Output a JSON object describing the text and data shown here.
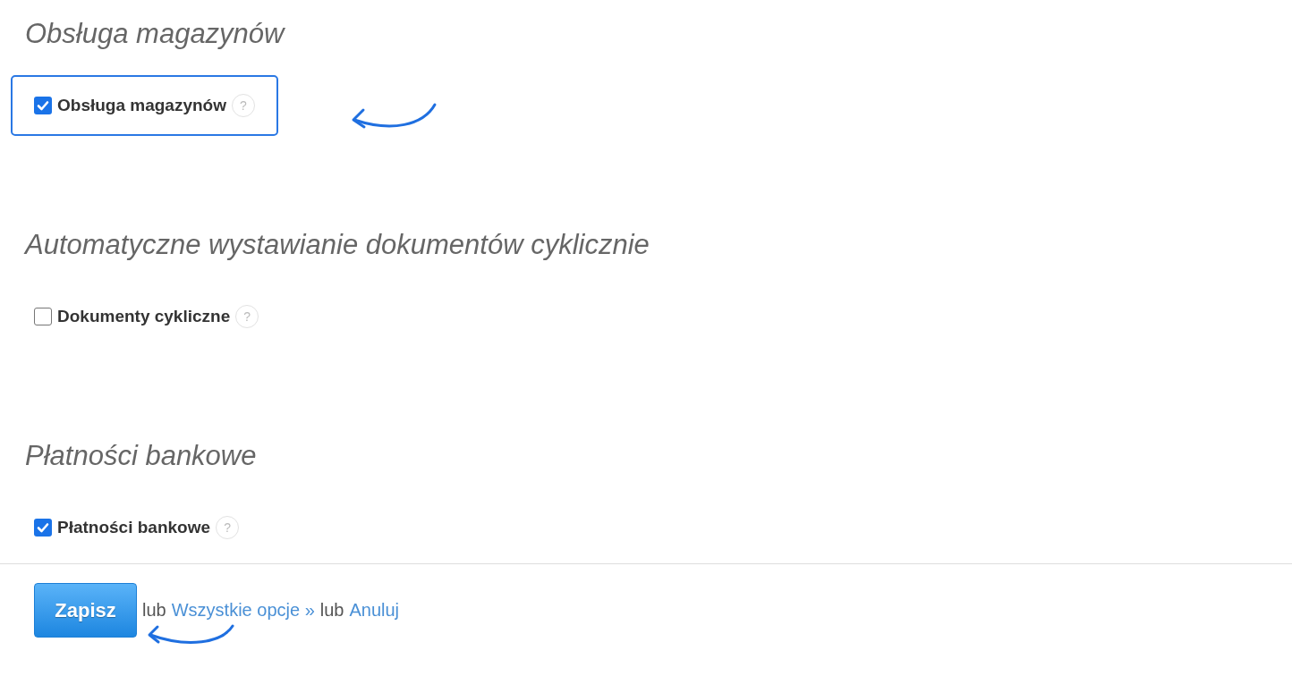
{
  "sections": [
    {
      "title": "Obsługa magazynów",
      "option": {
        "label": "Obsługa magazynów",
        "checked": true,
        "highlighted": true,
        "help": "?"
      }
    },
    {
      "title": "Automatyczne wystawianie dokumentów cyklicznie",
      "option": {
        "label": "Dokumenty cykliczne",
        "checked": false,
        "highlighted": false,
        "help": "?"
      }
    },
    {
      "title": "Płatności bankowe",
      "option": {
        "label": "Płatności bankowe",
        "checked": true,
        "highlighted": false,
        "help": "?"
      }
    }
  ],
  "footer": {
    "save_button": "Zapisz",
    "parts": [
      {
        "kind": "text",
        "text": "lub"
      },
      {
        "kind": "link",
        "text": "Wszystkie opcje »"
      },
      {
        "kind": "text",
        "text": "lub"
      },
      {
        "kind": "link",
        "text": "Anuluj"
      }
    ],
    "highlighted": true
  }
}
